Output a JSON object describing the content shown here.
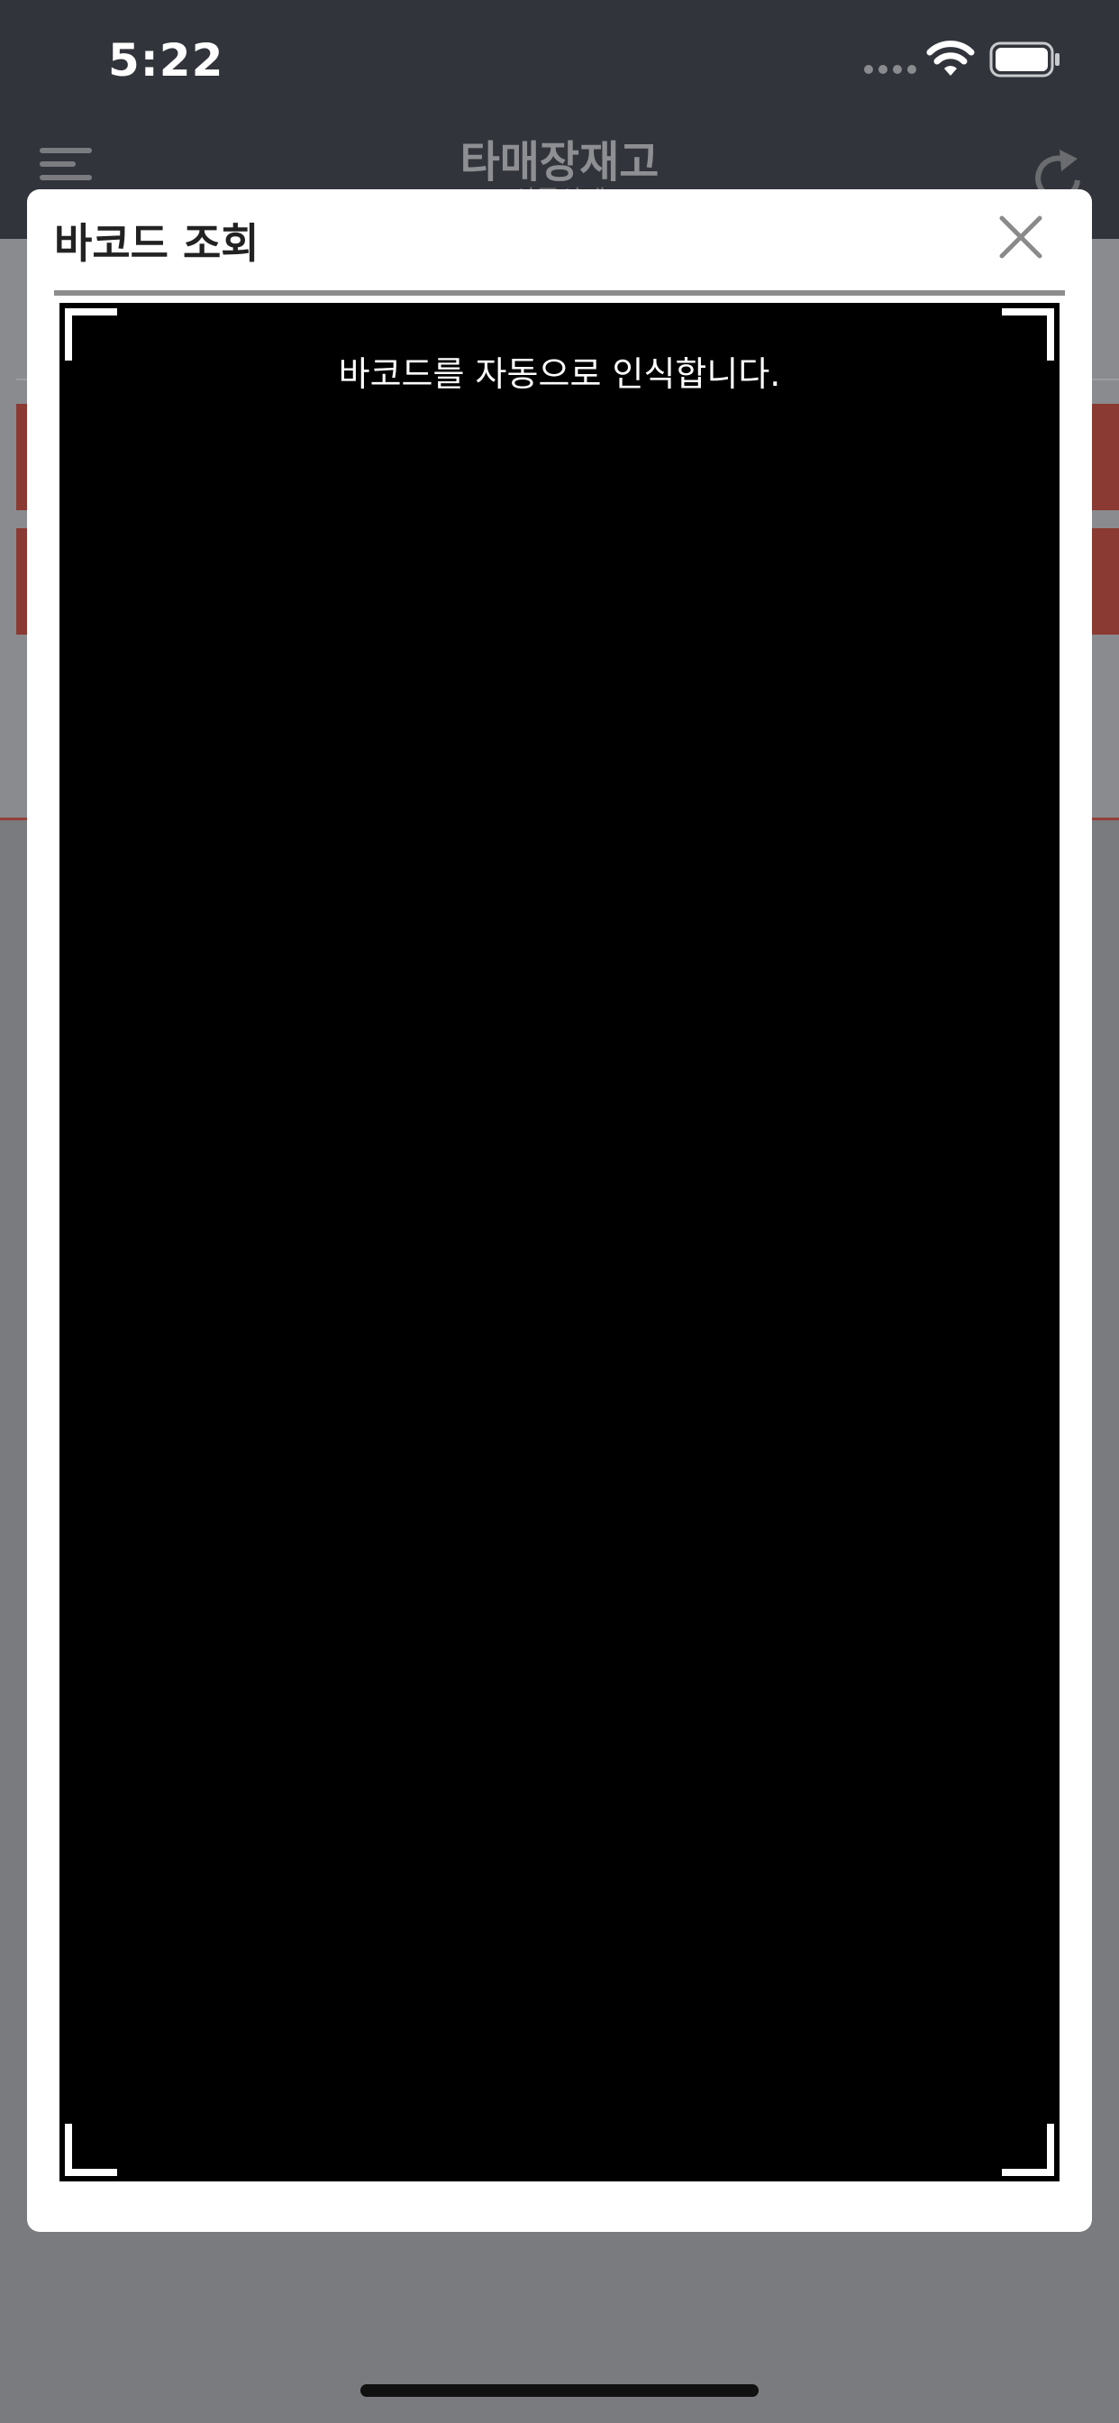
{
  "status_bar": {
    "time": "5:22"
  },
  "header": {
    "title": "타매장재고",
    "subtitle": "상품상세"
  },
  "modal": {
    "title": "바코드 조회",
    "scanner_hint": "바코드를 자동으로 인식합니다."
  },
  "icons": {
    "menu": "menu-icon",
    "refresh": "refresh-icon",
    "close": "close-icon",
    "wifi": "wifi-icon",
    "battery": "battery-icon"
  },
  "colors": {
    "status_bar_bg": "#32343b",
    "overlay": "#7a7b7e",
    "accent_red": "#c0392b",
    "modal_bg": "#ffffff",
    "scanner_bg": "#000000"
  }
}
